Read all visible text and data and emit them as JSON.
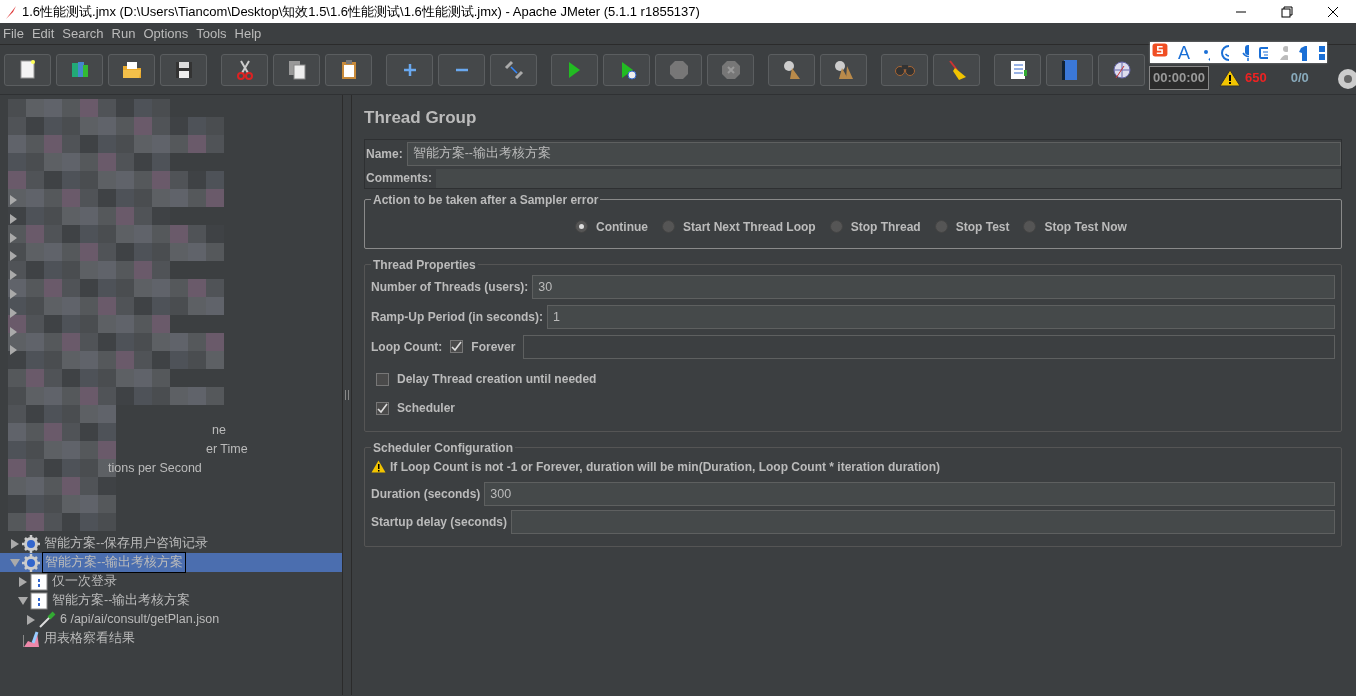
{
  "window": {
    "title": "1.6性能测试.jmx (D:\\Users\\Tiancom\\Desktop\\知效1.5\\1.6性能测试\\1.6性能测试.jmx) - Apache JMeter (5.1.1 r1855137)"
  },
  "menu": [
    "File",
    "Edit",
    "Search",
    "Run",
    "Options",
    "Tools",
    "Help"
  ],
  "toolbar": {
    "timer": "00:00:00",
    "error_count": "650",
    "threads": "0/0"
  },
  "ime_bar": {
    "letter": "A"
  },
  "tree": {
    "blurred_fragments": [
      "ne",
      "er Time",
      "tions per Second"
    ],
    "items": [
      {
        "label": "智能方案--保存用户咨询记录",
        "kind": "thread-group",
        "expanded": false,
        "selected": false
      },
      {
        "label": "智能方案--输出考核方案",
        "kind": "thread-group",
        "expanded": true,
        "selected": true,
        "children": [
          {
            "label": "仅一次登录",
            "kind": "controller",
            "expanded": false,
            "selected": false
          },
          {
            "label": "智能方案--输出考核方案",
            "kind": "controller",
            "expanded": true,
            "selected": false,
            "children": [
              {
                "label": "6 /api/ai/consult/getPlan.json",
                "kind": "sampler",
                "expanded": false,
                "selected": false
              }
            ]
          }
        ]
      },
      {
        "label": "用表格察看结果",
        "kind": "listener",
        "selected": false
      }
    ]
  },
  "panel": {
    "title": "Thread Group",
    "name_label": "Name:",
    "name_value": "智能方案--输出考核方案",
    "comments_label": "Comments:",
    "on_error": {
      "legend": "Action to be taken after a Sampler error",
      "options": [
        {
          "label": "Continue",
          "selected": true
        },
        {
          "label": "Start Next Thread Loop",
          "selected": false
        },
        {
          "label": "Stop Thread",
          "selected": false
        },
        {
          "label": "Stop Test",
          "selected": false
        },
        {
          "label": "Stop Test Now",
          "selected": false
        }
      ]
    },
    "thread_properties": {
      "legend": "Thread Properties",
      "fields": [
        {
          "label": "Number of Threads (users):",
          "value": "30"
        },
        {
          "label": "Ramp-Up Period (in seconds):",
          "value": "1"
        }
      ],
      "loop_label": "Loop Count:",
      "forever": {
        "label": "Forever",
        "checked": true
      },
      "delay": {
        "label": "Delay Thread creation until needed",
        "checked": false
      },
      "scheduler": {
        "label": "Scheduler",
        "checked": true
      }
    },
    "scheduler_config": {
      "legend": "Scheduler Configuration",
      "warning": "If Loop Count is not -1 or Forever, duration will be min(Duration, Loop Count * iteration duration)",
      "fields": [
        {
          "label": "Duration (seconds)",
          "value": "300"
        },
        {
          "label": "Startup delay (seconds)"
        }
      ]
    }
  }
}
